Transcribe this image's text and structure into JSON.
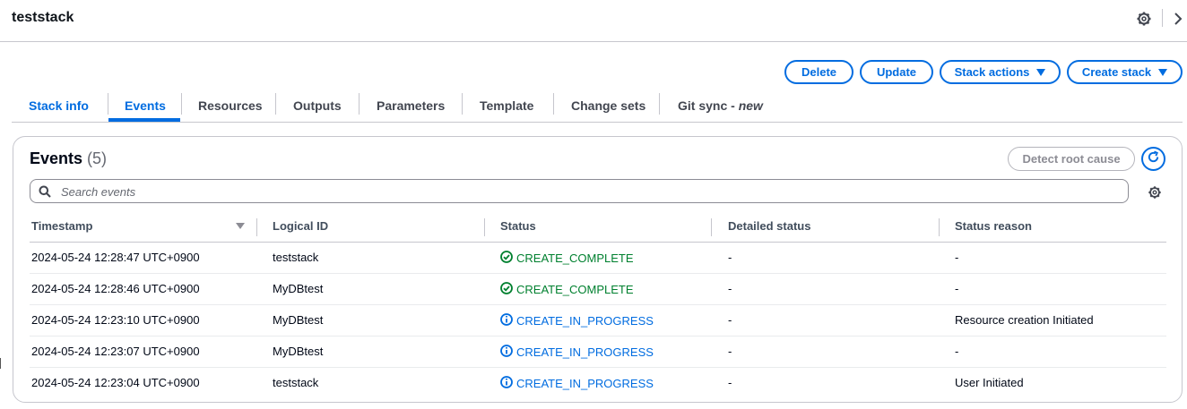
{
  "header": {
    "title": "teststack"
  },
  "actions": {
    "delete": "Delete",
    "update": "Update",
    "stack_actions": "Stack actions",
    "create_stack": "Create stack"
  },
  "tabs": [
    {
      "label": "Stack info"
    },
    {
      "label": "Events"
    },
    {
      "label": "Resources"
    },
    {
      "label": "Outputs"
    },
    {
      "label": "Parameters"
    },
    {
      "label": "Template"
    },
    {
      "label": "Change sets"
    },
    {
      "label": "Git sync",
      "suffix": "new"
    }
  ],
  "events": {
    "title": "Events",
    "count": "(5)",
    "detect_root_cause": "Detect root cause",
    "search_placeholder": "Search events",
    "columns": {
      "timestamp": "Timestamp",
      "logical_id": "Logical ID",
      "status": "Status",
      "detailed_status": "Detailed status",
      "status_reason": "Status reason"
    },
    "rows": [
      {
        "timestamp": "2024-05-24 12:28:47 UTC+0900",
        "logical_id": "teststack",
        "status": "CREATE_COMPLETE",
        "detailed_status": "-",
        "status_reason": "-"
      },
      {
        "timestamp": "2024-05-24 12:28:46 UTC+0900",
        "logical_id": "MyDBtest",
        "status": "CREATE_COMPLETE",
        "detailed_status": "-",
        "status_reason": "-"
      },
      {
        "timestamp": "2024-05-24 12:23:10 UTC+0900",
        "logical_id": "MyDBtest",
        "status": "CREATE_IN_PROGRESS",
        "detailed_status": "-",
        "status_reason": "Resource creation Initiated"
      },
      {
        "timestamp": "2024-05-24 12:23:07 UTC+0900",
        "logical_id": "MyDBtest",
        "status": "CREATE_IN_PROGRESS",
        "detailed_status": "-",
        "status_reason": "-"
      },
      {
        "timestamp": "2024-05-24 12:23:04 UTC+0900",
        "logical_id": "teststack",
        "status": "CREATE_IN_PROGRESS",
        "detailed_status": "-",
        "status_reason": "User Initiated"
      }
    ]
  },
  "colors": {
    "accent": "#006ce0",
    "success": "#00802f",
    "text": "#000716",
    "border": "#c6c6cd"
  },
  "icons": {
    "settings": "gear-icon",
    "collapse": "chevron-right-icon",
    "search": "search-icon",
    "refresh": "refresh-icon",
    "success": "check-circle-icon",
    "in_progress": "info-circle-icon"
  }
}
